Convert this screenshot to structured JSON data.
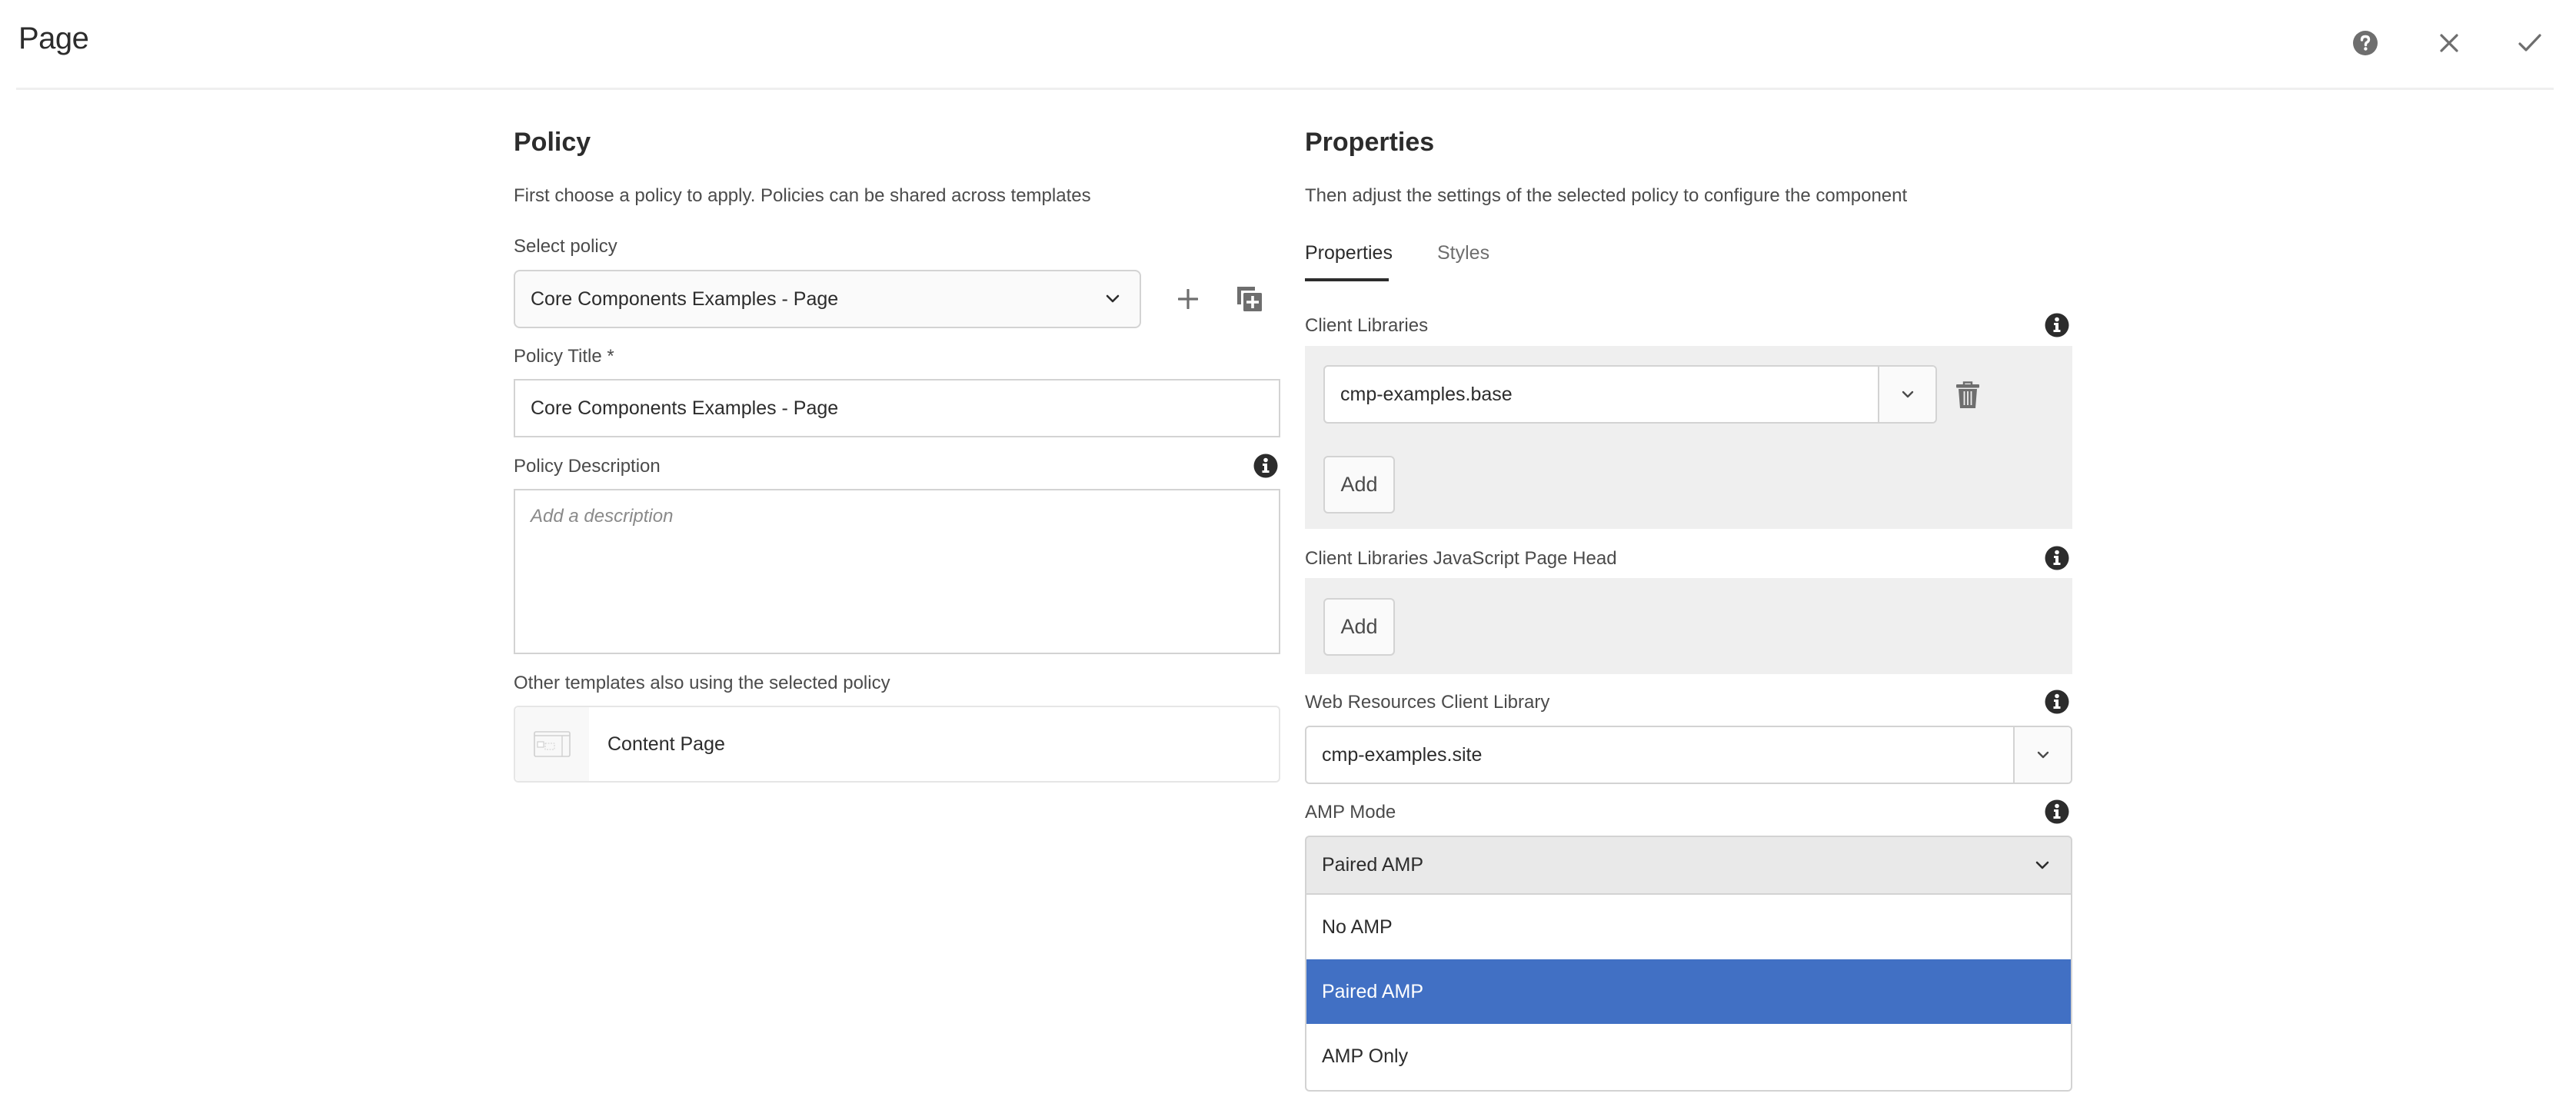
{
  "header": {
    "title": "Page",
    "icons": [
      "help-icon",
      "close-icon",
      "check-icon"
    ]
  },
  "policy": {
    "heading": "Policy",
    "description": "First choose a policy to apply. Policies can be shared across templates",
    "select_label": "Select policy",
    "select_value": "Core Components Examples - Page",
    "title_label": "Policy Title *",
    "title_value": "Core Components Examples - Page",
    "description_label": "Policy Description",
    "description_placeholder": "Add a description",
    "description_value": "",
    "other_templates_label": "Other templates also using the selected policy",
    "other_templates": [
      {
        "name": "Content Page"
      }
    ]
  },
  "properties": {
    "heading": "Properties",
    "description": "Then adjust the settings of the selected policy to configure the component",
    "tabs": [
      {
        "label": "Properties",
        "active": true
      },
      {
        "label": "Styles",
        "active": false
      }
    ],
    "client_libraries": {
      "label": "Client Libraries",
      "items": [
        "cmp-examples.base"
      ],
      "add_label": "Add"
    },
    "client_libraries_js_head": {
      "label": "Client Libraries JavaScript Page Head",
      "items": [],
      "add_label": "Add"
    },
    "web_resources": {
      "label": "Web Resources Client Library",
      "value": "cmp-examples.site"
    },
    "amp_mode": {
      "label": "AMP Mode",
      "value": "Paired AMP",
      "options": [
        {
          "label": "No AMP",
          "selected": false
        },
        {
          "label": "Paired AMP",
          "selected": true
        },
        {
          "label": "AMP Only",
          "selected": false
        }
      ]
    }
  },
  "colors": {
    "accent_selected": "#4170c4",
    "panel_bg": "#efefef",
    "border": "#d3d3d3",
    "icon": "#6e6e6e"
  }
}
